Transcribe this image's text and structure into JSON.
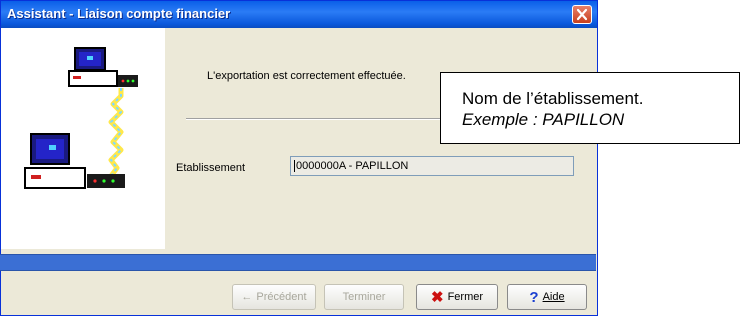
{
  "window": {
    "title": "Assistant - Liaison compte financier",
    "close_icon": "close-x-icon",
    "titlebar_color": "#0a5fe8"
  },
  "illustration": {
    "icon": "network-computers-icon"
  },
  "main": {
    "message": "L'exportation est correctement effectuée.",
    "etablissement_label": "Etablissement",
    "etablissement_value": "0000000A - PAPILLON"
  },
  "progress": {
    "color": "#3b6fd4",
    "value": 1.0
  },
  "buttons": {
    "previous": "Précédent",
    "finish": "Terminer",
    "close": "Fermer",
    "help": "Aide"
  },
  "callout": {
    "line1": "Nom de l’établissement.",
    "line2": "Exemple : PAPILLON"
  }
}
